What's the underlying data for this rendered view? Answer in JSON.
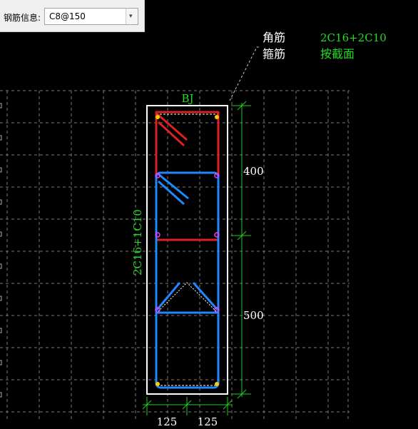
{
  "toolbar": {
    "rebar_info_label": "钢筋信息:",
    "rebar_info_value": "C8@150"
  },
  "drawing": {
    "tag": "BJ",
    "corner_bar_label": "角筋",
    "corner_bar_value": "2C16+2C10",
    "stirrup_label": "箍筋",
    "stirrup_value": "按截面",
    "side_bar_value": "2C16+1C10",
    "dim_upper": "400",
    "dim_lower": "500",
    "dim_bottom_left": "125",
    "dim_bottom_right": "125"
  },
  "colors": {
    "background": "#000000",
    "grid": "#7a7a7a",
    "outline": "#ffffff",
    "dimension": "#22cc22",
    "rebar_green_text": "#22dd22",
    "stirrup_red": "#dd2020",
    "stirrup_blue": "#1e88ff",
    "corner_dot": "#ffcc00",
    "side_dot": "#ff33ff"
  }
}
